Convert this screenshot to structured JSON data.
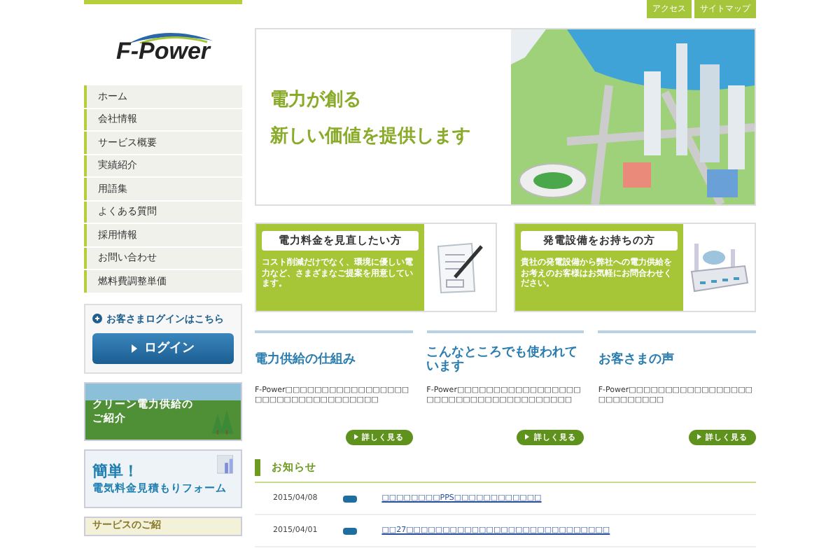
{
  "header_links": [
    "アクセス",
    "サイトマップ"
  ],
  "logo": {
    "text": "F-Power"
  },
  "nav": [
    {
      "label": "ホーム"
    },
    {
      "label": "会社情報"
    },
    {
      "label": "サービス概要"
    },
    {
      "label": "実績紹介"
    },
    {
      "label": "用語集"
    },
    {
      "label": "よくある質問"
    },
    {
      "label": "採用情報"
    },
    {
      "label": "お問い合わせ"
    },
    {
      "label": "燃料費調整単価"
    }
  ],
  "login": {
    "heading": "お客さまログインはこちら",
    "button": "ログイン"
  },
  "banners": [
    {
      "kind": "forest",
      "lines": [
        "クリーン電力供給の",
        "ご紹介"
      ]
    },
    {
      "kind": "form",
      "lines": [
        "簡単！",
        "電気料金見積もりフォーム"
      ]
    },
    {
      "kind": "partial",
      "lines": [
        "サービスのご紹"
      ]
    }
  ],
  "hero": {
    "lines": [
      "電力が創る",
      "新しい価値を提供します"
    ]
  },
  "cards": [
    {
      "kind": "document",
      "title": "電力料金を見直したい方",
      "text": "コスト削減だけでなく、環境に優しい電力など、さまざまなご提案を用意しています。"
    },
    {
      "kind": "factory",
      "title": "発電設備をお持ちの方",
      "text": "貴社の発電設備から弊社への電力供給をお考えのお客様はお気軽にお問合わせください。"
    }
  ],
  "columns": [
    {
      "title": "電力供給の仕組み",
      "text": "F-Power□□□□□□□□□□□□□□□□□□□□□□□□□□□□□□□□□□",
      "more": "詳しく見る"
    },
    {
      "title": "こんなところでも使われています",
      "text": "F-Power□□□□□□□□□□□□□□□□□□□□□□□□□□□□□□□□□□□□□",
      "more": "詳しく見る"
    },
    {
      "title": "お客さまの声",
      "text": "F-Power□□□□□□□□□□□□□□□□□□□□□□□□□□",
      "more": "詳しく見る"
    }
  ],
  "news": {
    "title": "お知らせ",
    "items": [
      {
        "date": "2015/04/08",
        "text": "□□□□□□□□PPS□□□□□□□□□□□□"
      },
      {
        "date": "2015/04/01",
        "text": "□□27□□□□□□□□□□□□□□□□□□□□□□□□□□□□"
      }
    ]
  }
}
